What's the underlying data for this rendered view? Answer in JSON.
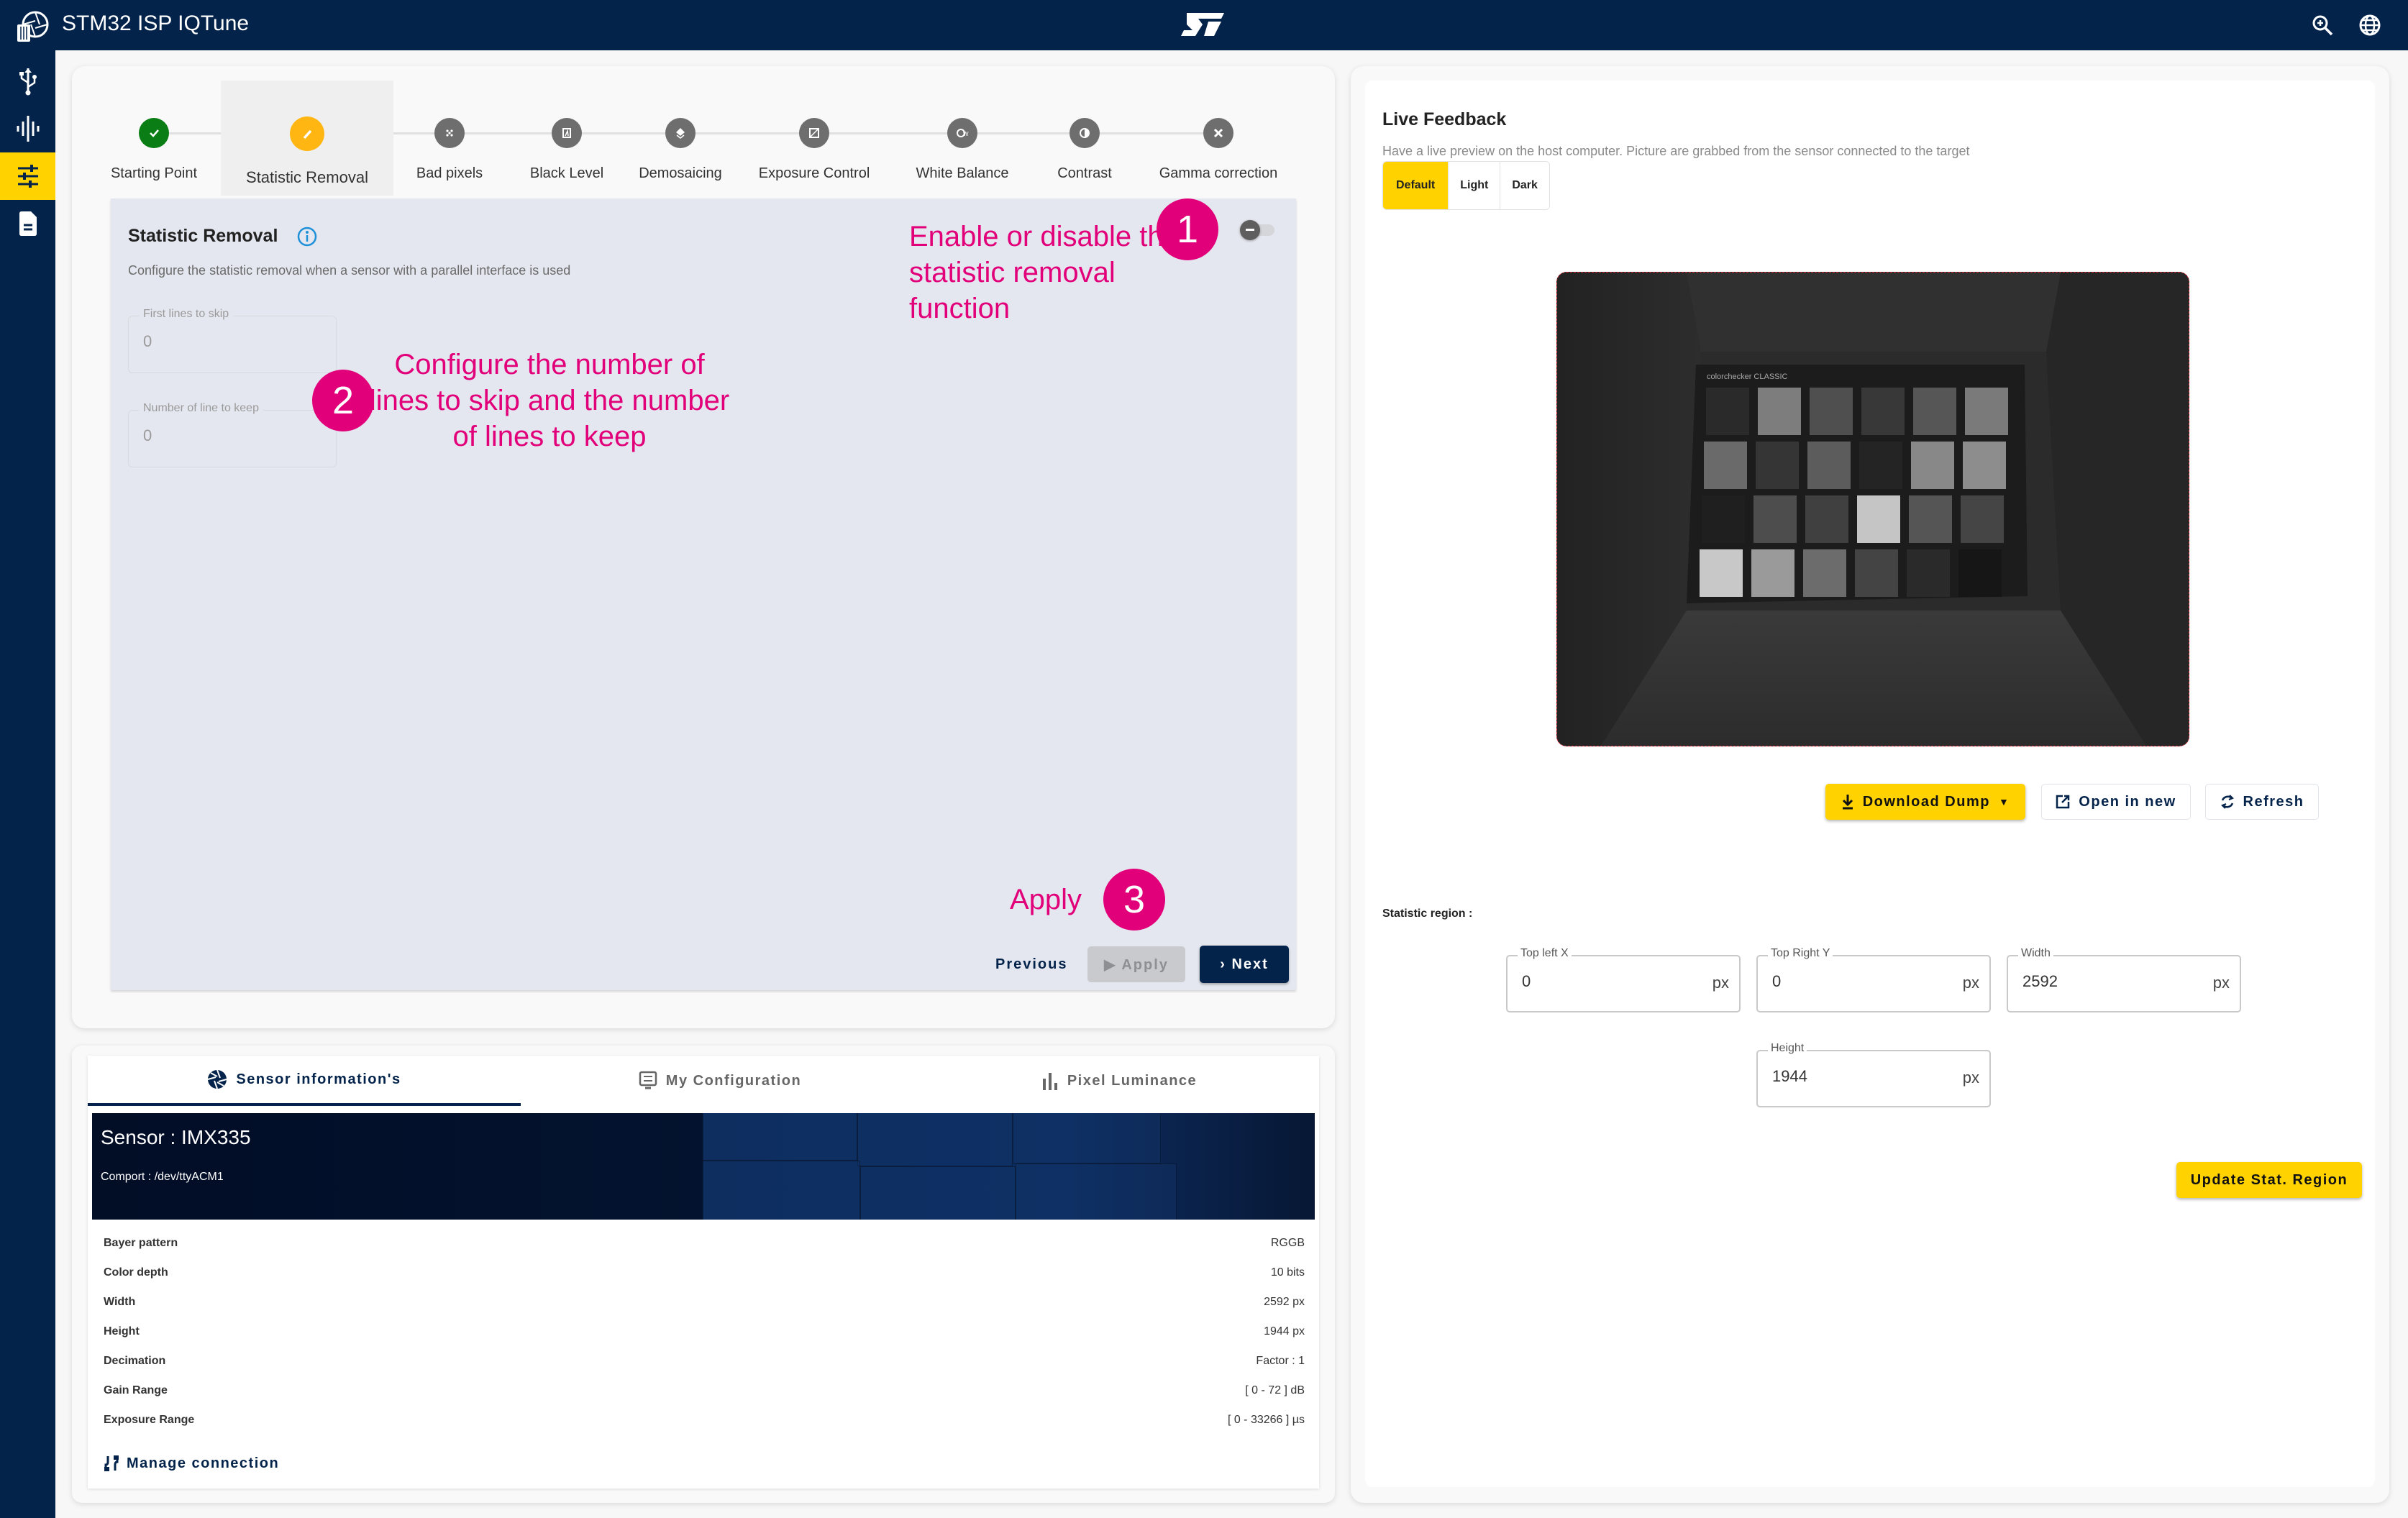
{
  "app": {
    "title": "STM32 ISP IQTune"
  },
  "topbar": {
    "icons": [
      "zoom-in-icon",
      "globe-icon"
    ]
  },
  "sidebar": {
    "items": [
      {
        "name": "usb-connection",
        "icon": "usb-icon",
        "active": false
      },
      {
        "name": "audio-waveform",
        "icon": "waveform-icon",
        "active": false
      },
      {
        "name": "tuning",
        "icon": "sliders-icon",
        "active": true
      },
      {
        "name": "document",
        "icon": "document-icon",
        "active": false
      }
    ]
  },
  "stepper": {
    "steps": [
      {
        "label": "Starting Point",
        "state": "done",
        "icon": "check-icon"
      },
      {
        "label": "Statistic Removal",
        "state": "current",
        "icon": "pencil-icon"
      },
      {
        "label": "Bad pixels",
        "state": "pending",
        "icon": "dots-grid-icon"
      },
      {
        "label": "Black Level",
        "state": "pending",
        "icon": "black-level-icon"
      },
      {
        "label": "Demosaicing",
        "state": "pending",
        "icon": "layers-icon"
      },
      {
        "label": "Exposure Control",
        "state": "pending",
        "icon": "exposure-icon"
      },
      {
        "label": "White Balance",
        "state": "pending",
        "icon": "awb-icon"
      },
      {
        "label": "Contrast",
        "state": "pending",
        "icon": "contrast-icon"
      },
      {
        "label": "Gamma correction",
        "state": "pending",
        "icon": "gamma-icon"
      }
    ]
  },
  "statistic_removal": {
    "title": "Statistic Removal",
    "description": "Configure the statistic removal when a sensor with a parallel interface is used",
    "enabled": false,
    "fields": [
      {
        "label": "First lines to skip",
        "value": "0"
      },
      {
        "label": "Number of line to keep",
        "value": "0"
      }
    ],
    "buttons": {
      "previous": "Previous",
      "apply": "Apply",
      "next": "Next"
    }
  },
  "annotations": [
    {
      "number": "1",
      "text": "Enable or disable the statistic removal function"
    },
    {
      "number": "2",
      "text": "Configure the number of lines to skip and the number of lines to keep"
    },
    {
      "number": "3",
      "text": "Apply"
    }
  ],
  "sensor_card": {
    "tabs": [
      {
        "label": "Sensor information's",
        "icon": "aperture-icon",
        "active": true
      },
      {
        "label": "My Configuration",
        "icon": "monitor-settings-icon",
        "active": false
      },
      {
        "label": "Pixel Luminance",
        "icon": "bar-chart-icon",
        "active": false
      }
    ],
    "sensor_title": "Sensor : IMX335",
    "comport": "Comport : /dev/ttyACM1",
    "rows": [
      {
        "key": "Bayer pattern",
        "value": "RGGB"
      },
      {
        "key": "Color depth",
        "value": "10 bits"
      },
      {
        "key": "Width",
        "value": "2592 px"
      },
      {
        "key": "Height",
        "value": "1944 px"
      },
      {
        "key": "Decimation",
        "value": "Factor : 1"
      },
      {
        "key": "Gain Range",
        "value": "[ 0 - 72 ] dB"
      },
      {
        "key": "Exposure Range",
        "value": "[ 0 - 33266 ] µs"
      }
    ],
    "manage_connection": "Manage connection"
  },
  "live_feedback": {
    "title": "Live Feedback",
    "description": "Have a live preview on the host computer. Picture are grabbed from the sensor connected to the target",
    "modes": [
      {
        "label": "Default",
        "active": true
      },
      {
        "label": "Light",
        "active": false
      },
      {
        "label": "Dark",
        "active": false
      }
    ],
    "preview_caption": "colorchecker CLASSIC",
    "buttons": {
      "download": "Download Dump",
      "open_new": "Open in new",
      "refresh": "Refresh"
    },
    "stat_region_label": "Statistic region :",
    "stat_fields": [
      {
        "label": "Top left X",
        "value": "0",
        "unit": "px"
      },
      {
        "label": "Top Right Y",
        "value": "0",
        "unit": "px"
      },
      {
        "label": "Width",
        "value": "2592",
        "unit": "px"
      },
      {
        "label": "Height",
        "value": "1944",
        "unit": "px"
      }
    ],
    "update_button": "Update Stat. Region"
  },
  "colors": {
    "brand_navy": "#03234b",
    "brand_yellow": "#ffd200",
    "annotation_magenta": "#e2007a",
    "step_done": "#0a7d14",
    "step_current": "#ffb612"
  }
}
